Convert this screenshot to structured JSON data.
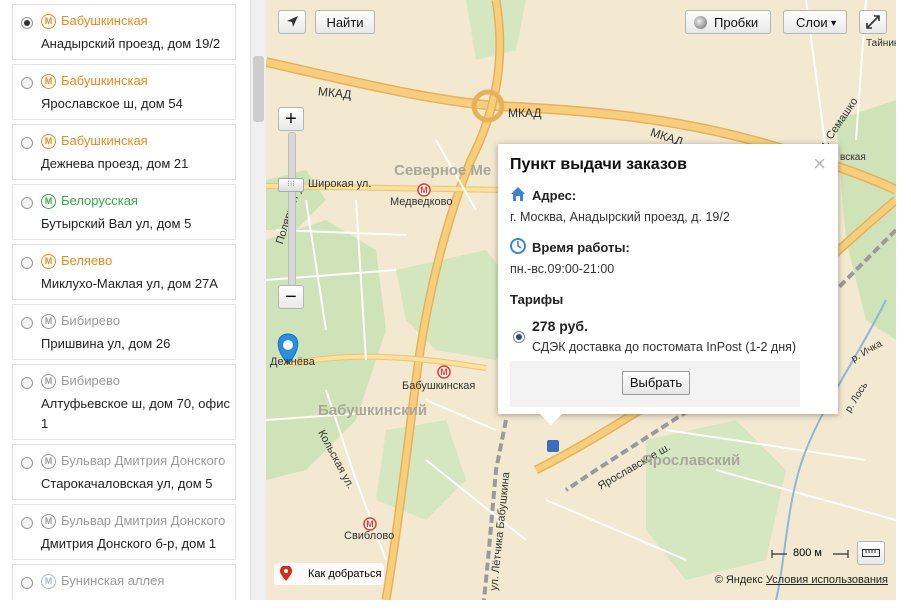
{
  "list": {
    "items": [
      {
        "station": "Бабушкинская",
        "address": "Анадырский проезд, дом 19/2",
        "metro_color": "#e88a1a",
        "selected": true
      },
      {
        "station": "Бабушкинская",
        "address": "Ярославское ш, дом 54",
        "metro_color": "#e88a1a",
        "selected": false
      },
      {
        "station": "Бабушкинская",
        "address": "Дежнева проезд, дом 21",
        "metro_color": "#e88a1a",
        "selected": false
      },
      {
        "station": "Белорусская",
        "address": "Бутырский Вал ул, дом 5",
        "metro_color": "#3aa94a",
        "selected": false
      },
      {
        "station": "Беляево",
        "address": "Миклухо-Маклая ул, дом 27А",
        "metro_color": "#e88a1a",
        "selected": false
      },
      {
        "station": "Бибирево",
        "address": "Пришвина ул, дом 26",
        "metro_color": "#9a9a9a",
        "selected": false
      },
      {
        "station": "Бибирево",
        "address": "Алтуфьевское ш, дом 70, офис 1",
        "metro_color": "#9a9a9a",
        "selected": false
      },
      {
        "station": "Бульвар Дмитрия Донского",
        "address": "Старокачаловская ул, дом 5",
        "metro_color": "#9a9a9a",
        "selected": false
      },
      {
        "station": "Бульвар Дмитрия Донского",
        "address": "Дмитрия Донского б-р, дом 1",
        "metro_color": "#9a9a9a",
        "selected": false
      },
      {
        "station": "Бунинская аллея",
        "address": "",
        "metro_color": "#a8b8d8",
        "selected": false
      }
    ],
    "metro_symbol": "М"
  },
  "map": {
    "find_button": "Найти",
    "traffic_button": "Пробки",
    "layers_button": "Слои",
    "zoom_in": "+",
    "zoom_out": "−",
    "labels": {
      "mkad_left": "МКАД",
      "mkad_mid": "МКАД",
      "mkad_right": "МКАД",
      "shirokaya": "Широкая ул.",
      "polyarnaya": "Полярная ул.",
      "medvedkovo": "Медведково",
      "babushkinskaya": "Бабушкинская",
      "sviblovo": "Свиблово",
      "dezhneva": "Дежнёва",
      "kolskaya": "Кольская ул.",
      "letchika": "ул. Лётчика Бабушкина",
      "yaroslavskoe": "Ярославское ш.",
      "semashko": "ул. Семашко",
      "ichka": "р. Ичка",
      "los": "р. Лось",
      "taynin": "Тайнин",
      "vskaya": "вская"
    },
    "districts": {
      "severnoe": "Северное Ме",
      "babushkinsky": "Бабушкинский",
      "yaroslavsky": "Ярославский"
    },
    "route_label": "Как добраться",
    "scale": "800 м",
    "copyright_brand": "© Яндекс",
    "terms_link": "Условия использования"
  },
  "popup": {
    "title": "Пункт выдачи заказов",
    "close": "×",
    "address_header": "Адрес:",
    "address_value": "г. Москва, Анадырский проезд, д. 19/2",
    "hours_header": "Время работы:",
    "hours_value": "пн.-вс.09:00-21:00",
    "tariffs_header": "Тарифы",
    "price": "278 руб.",
    "service": "СДЭК доставка до постомата InPost (1-2 дня)",
    "select_button": "Выбрать"
  }
}
